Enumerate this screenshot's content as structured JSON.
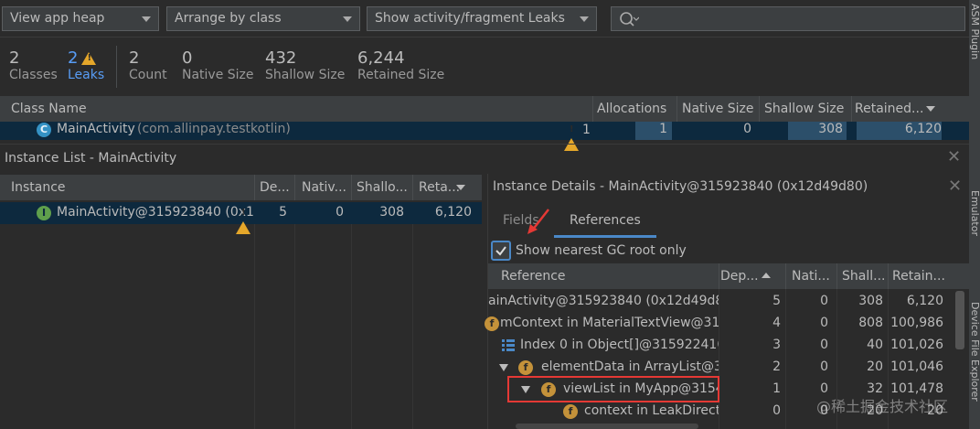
{
  "toolbar": {
    "heap_select": "View app heap",
    "arrange_select": "Arrange by class",
    "filter_select": "Show activity/fragment Leaks",
    "search_placeholder": ""
  },
  "stats": [
    {
      "value": "2",
      "label": "Classes"
    },
    {
      "value": "2",
      "label": "Leaks"
    },
    {
      "value": "2",
      "label": "Count"
    },
    {
      "value": "0",
      "label": "Native Size"
    },
    {
      "value": "432",
      "label": "Shallow Size"
    },
    {
      "value": "6,244",
      "label": "Retained Size"
    }
  ],
  "class_table": {
    "headers": [
      "Class Name",
      "Allocations",
      "Native Size",
      "Shallow Size",
      "Retained..."
    ],
    "row": {
      "name": "MainActivity",
      "package": "(com.allinpay.testkotlin)",
      "leaks": "1",
      "allocations": "1",
      "native": "0",
      "shallow": "308",
      "retained": "6,120"
    }
  },
  "instance_list": {
    "title": "Instance List - MainActivity",
    "headers": [
      "Instance",
      "De...",
      "Nativ...",
      "Shallo...",
      "Reta..."
    ],
    "row": {
      "name": "MainActivity@315923840 (0x12",
      "depth": "5",
      "native": "0",
      "shallow": "308",
      "retained": "6,120"
    }
  },
  "details": {
    "title": "Instance Details - MainActivity@315923840 (0x12d49d80)",
    "tabs": [
      "Fields",
      "References"
    ],
    "checkbox_label": "Show nearest GC root only",
    "headers": [
      "Reference",
      "Dep...",
      "Nati...",
      "Shall...",
      "Retain..."
    ],
    "rows": [
      {
        "text": "ainActivity@315923840 (0x12d49d80)",
        "depth": "5",
        "native": "0",
        "shallow": "308",
        "retained": "6,120"
      },
      {
        "text": "mContext in MaterialTextView@315",
        "depth": "4",
        "native": "0",
        "shallow": "808",
        "retained": "100,986"
      },
      {
        "text": "Index 0 in Object[]@315922416 (",
        "depth": "3",
        "native": "0",
        "shallow": "40",
        "retained": "101,026"
      },
      {
        "text": "elementData in ArrayList@31",
        "depth": "2",
        "native": "0",
        "shallow": "20",
        "retained": "101,046"
      },
      {
        "text": "viewList in MyApp@3154",
        "depth": "1",
        "native": "0",
        "shallow": "32",
        "retained": "101,478"
      },
      {
        "text": "context in LeakDirecto",
        "depth": "0",
        "native": "0",
        "shallow": "20",
        "retained": "20"
      }
    ]
  },
  "side_panel": [
    "ASM Plugin",
    "Emulator",
    "Device File Explorer"
  ],
  "watermark": "@稀土掘金技术社区"
}
